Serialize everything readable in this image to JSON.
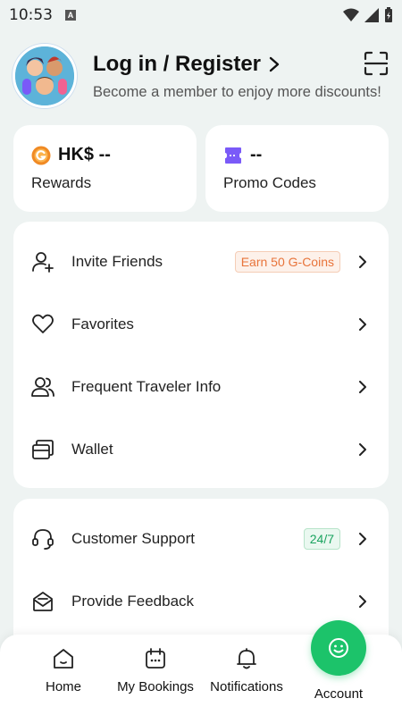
{
  "status_bar": {
    "time": "10:53",
    "notif_letter": "A"
  },
  "profile": {
    "title": "Log in / Register",
    "subtitle": "Become a member to enjoy more discounts!"
  },
  "stats": {
    "rewards": {
      "value": "HK$ --",
      "label": "Rewards",
      "icon": "g-coin-icon",
      "color": "#f08a24"
    },
    "promo": {
      "value": "--",
      "label": "Promo Codes",
      "icon": "ticket-icon",
      "color": "#7a5af8"
    }
  },
  "menu_one": [
    {
      "label": "Invite Friends",
      "icon": "add-user-icon",
      "badge": "Earn 50 G-Coins"
    },
    {
      "label": "Favorites",
      "icon": "heart-icon"
    },
    {
      "label": "Frequent Traveler Info",
      "icon": "users-icon"
    },
    {
      "label": "Wallet",
      "icon": "wallet-icon"
    }
  ],
  "menu_two": [
    {
      "label": "Customer Support",
      "icon": "headset-icon",
      "badge": "24/7"
    },
    {
      "label": "Provide Feedback",
      "icon": "feedback-icon"
    }
  ],
  "nav": {
    "home": "Home",
    "bookings": "My Bookings",
    "notifications": "Notifications",
    "account": "Account"
  },
  "colors": {
    "accent": "#1cc36a",
    "badge_orange": "#e8743b",
    "badge_green": "#1aa35f"
  }
}
